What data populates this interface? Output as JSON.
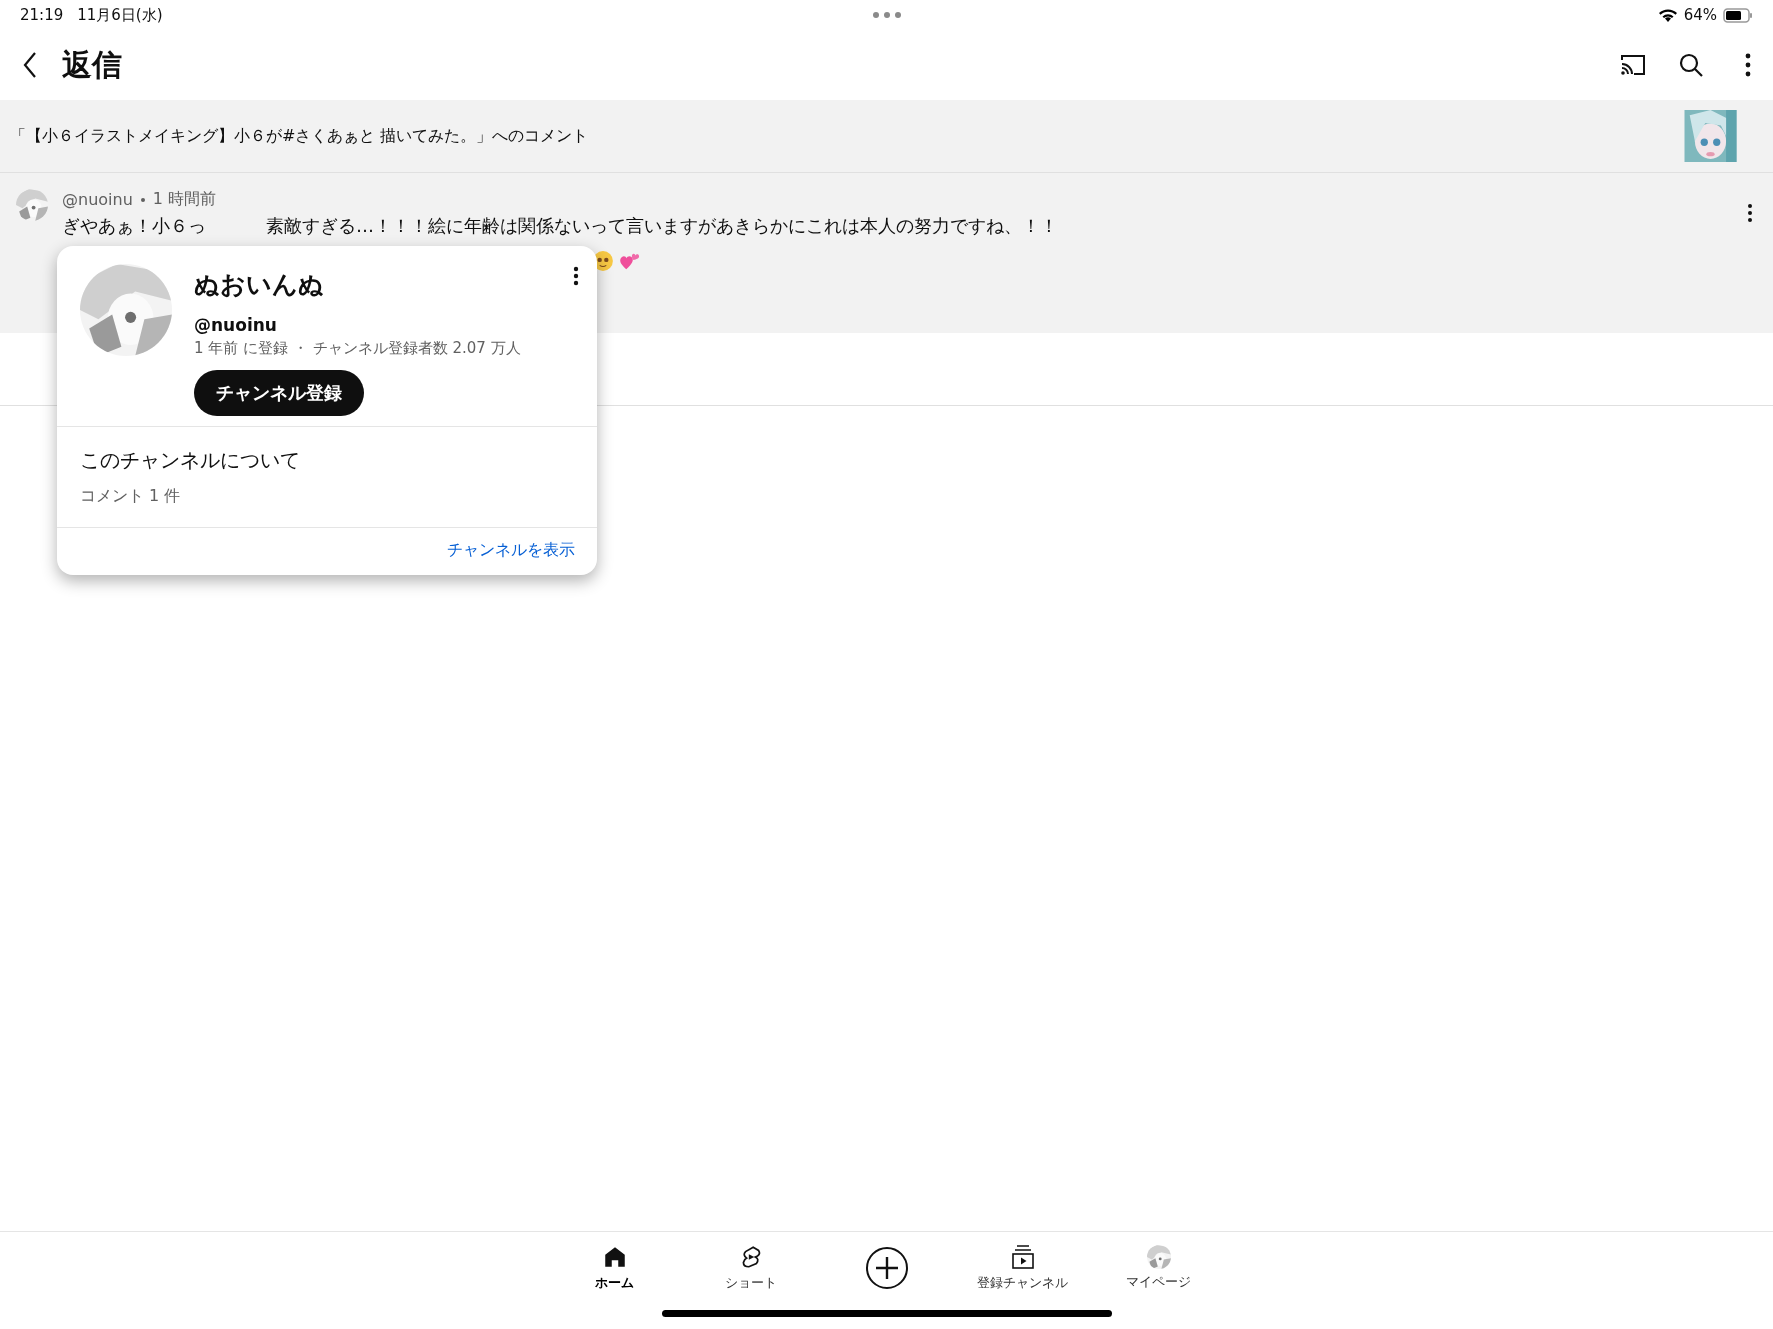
{
  "status_bar": {
    "time": "21:19",
    "date": "11月6日(水)",
    "battery": "64%"
  },
  "header": {
    "title": "返信"
  },
  "video": {
    "title": "「【小６イラストメイキング】小６が#さくあぁと 描いてみた。」へのコメント"
  },
  "comment": {
    "author": "@nuoinu",
    "time": "1 時間前",
    "text_parts": [
      "ぎやあぁ！小６っ",
      "素敵すぎる…！！！絵に年齢は関係ないって言いますがあきらかにこれは本人の努力ですね、！！"
    ]
  },
  "channel_card": {
    "name": "ぬおいんぬ",
    "handle": "@nuoinu",
    "meta": "1 年前 に登録 ・ チャンネル登録者数 2.07 万人",
    "subscribe_button": "チャンネル登録",
    "about_title": "このチャンネルについて",
    "comment_count": "コメント 1 件",
    "view_channel_link": "チャンネルを表示"
  },
  "bottom_nav": [
    {
      "kind": "home",
      "label": "ホーム",
      "selected": true
    },
    {
      "kind": "shorts",
      "label": "ショート",
      "selected": false
    },
    {
      "kind": "create",
      "selected": false
    },
    {
      "kind": "subscriptions",
      "label": "登録チャンネル",
      "selected": false
    },
    {
      "kind": "mypage",
      "label": "マイページ",
      "selected": false
    }
  ]
}
